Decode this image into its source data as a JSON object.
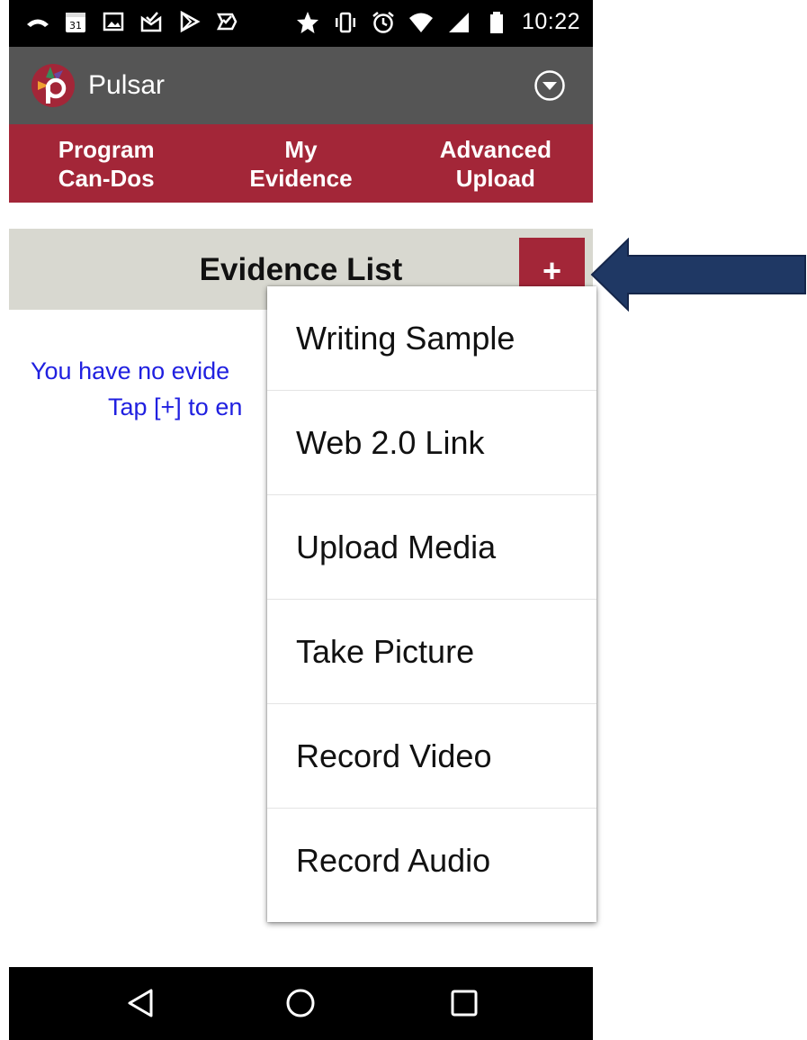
{
  "status_bar": {
    "time": "10:22",
    "calendar_day": "31",
    "left_icons": [
      "missed-call-icon",
      "calendar-icon",
      "image-icon",
      "mail-check-icon",
      "play-store-icon",
      "task-icon"
    ],
    "right_icons": [
      "star-icon",
      "vibrate-icon",
      "alarm-icon",
      "wifi-icon",
      "signal-icon",
      "battery-icon"
    ]
  },
  "app_bar": {
    "title": "Pulsar",
    "logo_letter": "p",
    "overflow_icon": "chevron-down-circle-icon"
  },
  "tabs": [
    {
      "line1": "Program",
      "line2": "Can-Dos"
    },
    {
      "line1": "My",
      "line2": "Evidence"
    },
    {
      "line1": "Advanced",
      "line2": "Upload"
    }
  ],
  "evidence": {
    "title": "Evidence List",
    "add_label": "+",
    "empty_line1": "You have no evide",
    "empty_line2": "Tap [+] to en"
  },
  "menu": {
    "items": [
      {
        "label": "Writing Sample"
      },
      {
        "label": "Web 2.0 Link"
      },
      {
        "label": "Upload Media"
      },
      {
        "label": "Take Picture"
      },
      {
        "label": "Record Video"
      },
      {
        "label": "Record Audio"
      }
    ]
  },
  "nav_bar": {
    "icons": [
      "back-icon",
      "home-icon",
      "recents-icon"
    ]
  },
  "colors": {
    "brand_red": "#a32638",
    "app_bar_gray": "#555555",
    "header_bg": "#d8d8d0",
    "message_blue": "#2020e0",
    "arrow_navy": "#1f3864"
  }
}
